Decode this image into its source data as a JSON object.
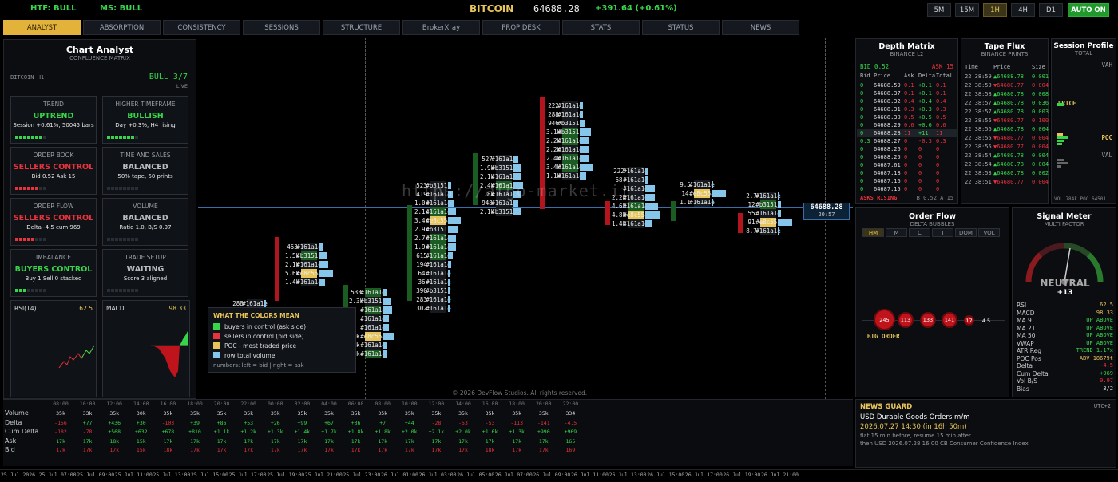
{
  "topbar": {
    "htf": "HTF: BULL",
    "ms": "MS: BULL",
    "symbol": "BITCOIN",
    "price": "64688.28",
    "change": "+391.64 (+0.61%)",
    "timeframes": [
      "5M",
      "15M",
      "1H",
      "4H",
      "D1"
    ],
    "auto": "AUTO ON"
  },
  "tabs": [
    "ANALYST",
    "ABSORPTION",
    "CONSISTENCY",
    "SESSIONS",
    "STRUCTURE",
    "BrokerXray",
    "PROP DESK",
    "STATS",
    "STATUS",
    "NEWS"
  ],
  "analyst": {
    "title": "Chart Analyst",
    "subtitle": "CONFLUENCE MATRIX",
    "symbol": "BITCOIN  H1",
    "bull": "BULL 3/7",
    "live": "LIVE",
    "cards": [
      {
        "h": "TREND",
        "v": "UPTREND",
        "s": "Session +0.61%, 50045 bars",
        "c": "green",
        "n": 7
      },
      {
        "h": "HIGHER TIMEFRAME",
        "v": "BULLISH",
        "s": "Day +0.3%, H4 rising",
        "c": "green",
        "n": 7
      },
      {
        "h": "ORDER BOOK",
        "v": "SELLERS CONTROL",
        "s": "Bid 0.52  Ask 15",
        "c": "red",
        "n": 6
      },
      {
        "h": "TIME AND SALES",
        "v": "BALANCED",
        "s": "50% tape, 60 prints",
        "c": "gray",
        "n": 0
      },
      {
        "h": "ORDER FLOW",
        "v": "SELLERS CONTROL",
        "s": "Delta -4.5 cum 969",
        "c": "red",
        "n": 5
      },
      {
        "h": "VOLUME",
        "v": "BALANCED",
        "s": "Ratio 1.0, B/S 0.97",
        "c": "gray",
        "n": 0
      },
      {
        "h": "IMBALANCE",
        "v": "BUYERS CONTROL",
        "s": "Buy 1  Sell 0 stacked",
        "c": "green",
        "n": 3
      },
      {
        "h": "TRADE SETUP",
        "v": "WAITING",
        "s": "Score 3 aligned",
        "c": "gray",
        "n": 0
      }
    ],
    "rsi_label": "RSI(14)",
    "rsi": "62.5",
    "macd_label": "MACD",
    "macd": "98.33"
  },
  "legend": {
    "title": "WHAT THE COLORS MEAN",
    "items": [
      "buyers in control (ask side)",
      "sellers in control (bid side)",
      "POC - most traded price",
      "row total volume"
    ],
    "note": "numbers:  left = bid  |  right = ask"
  },
  "watermark": "https://algo-market.it",
  "copyright": "© 2026 DevFlow Studios. All rights reserved.",
  "price_tag": {
    "price": "64688.28",
    "timer": "20:57"
  },
  "stats_table": {
    "labels": [
      "Volume",
      "Delta",
      "Cum Delta",
      "Ask",
      "Bid"
    ],
    "times": [
      "08:00",
      "10:00",
      "12:00",
      "14:00",
      "16:00",
      "18:00",
      "20:00",
      "22:00",
      "00:00",
      "02:00",
      "04:00",
      "06:00",
      "08:00",
      "10:00",
      "12:00",
      "14:00",
      "16:00",
      "18:00",
      "20:00",
      "22:00"
    ],
    "volume": [
      "35k",
      "33k",
      "35k",
      "30k",
      "35k",
      "35k",
      "35k",
      "35k",
      "35k",
      "35k",
      "35k",
      "35k",
      "35k",
      "35k",
      "35k",
      "35k",
      "35k",
      "35k",
      "35k",
      "334"
    ],
    "delta": [
      "-156",
      "+77",
      "+436",
      "+30",
      "-103",
      "+39",
      "+86",
      "+53",
      "+26",
      "+99",
      "+67",
      "+36",
      "+7",
      "+44",
      "-28",
      "-53",
      "-53",
      "-113",
      "-141",
      "-4.5"
    ],
    "cumdelta": [
      "-182",
      "-78",
      "+568",
      "+632",
      "+678",
      "+810",
      "+1.1k",
      "+1.2k",
      "+1.3k",
      "+1.4k",
      "+1.7k",
      "+1.8k",
      "+1.8k",
      "+2.0k",
      "+2.1k",
      "+2.0k",
      "+1.6k",
      "+1.3k",
      "+990",
      "+969"
    ],
    "ask": [
      "17k",
      "17k",
      "18k",
      "15k",
      "17k",
      "17k",
      "17k",
      "17k",
      "17k",
      "17k",
      "17k",
      "17k",
      "17k",
      "17k",
      "17k",
      "17k",
      "17k",
      "17k",
      "17k",
      "165"
    ],
    "bid": [
      "17k",
      "17k",
      "17k",
      "15k",
      "18k",
      "17k",
      "17k",
      "17k",
      "17k",
      "17k",
      "17k",
      "17k",
      "17k",
      "17k",
      "17k",
      "17k",
      "18k",
      "17k",
      "17k",
      "169"
    ]
  },
  "dates": [
    "25 Jul 2026",
    "25 Jul 07:00",
    "25 Jul 09:00",
    "25 Jul 11:00",
    "25 Jul 13:00",
    "25 Jul 15:00",
    "25 Jul 17:00",
    "25 Jul 19:00",
    "25 Jul 21:00",
    "25 Jul 23:00",
    "26 Jul 01:00",
    "26 Jul 03:00",
    "26 Jul 05:00",
    "26 Jul 07:00",
    "26 Jul 09:00",
    "26 Jul 11:00",
    "26 Jul 13:00",
    "26 Jul 15:00",
    "26 Jul 17:00",
    "26 Jul 19:00",
    "26 Jul 21:00"
  ],
  "depth": {
    "title": "Depth Matrix",
    "sub": "BINANCE L2",
    "bid": "BID 0.52",
    "ask": "ASK 15",
    "cols": [
      "Bid",
      "Price",
      "Ask",
      "Delta",
      "Total"
    ],
    "rows": [
      [
        "0",
        "64688.59",
        "0.1",
        "+0.1",
        "0.1"
      ],
      [
        "0",
        "64688.37",
        "0.1",
        "+0.1",
        "0.1"
      ],
      [
        "0",
        "64688.32",
        "0.4",
        "+0.4",
        "0.4"
      ],
      [
        "0",
        "64688.31",
        "0.3",
        "+0.3",
        "0.3"
      ],
      [
        "0",
        "64688.30",
        "0.5",
        "+0.5",
        "0.5"
      ],
      [
        "0",
        "64688.29",
        "0.6",
        "+0.6",
        "0.6"
      ],
      [
        "0",
        "64688.28",
        "11",
        "+11",
        "11"
      ],
      [
        "0.3",
        "64688.27",
        "0",
        "-0.3",
        "0.3"
      ],
      [
        "0",
        "64688.26",
        "0",
        "0",
        "0"
      ],
      [
        "0",
        "64688.25",
        "0",
        "0",
        "0"
      ],
      [
        "0",
        "64687.61",
        "0",
        "0",
        "0"
      ],
      [
        "0",
        "64687.18",
        "0",
        "0",
        "0"
      ],
      [
        "0",
        "64687.16",
        "0",
        "0",
        "0"
      ],
      [
        "0",
        "64687.15",
        "0",
        "0",
        "0"
      ]
    ],
    "foot": "ASKS RISING",
    "foot2": "B 0.52  A 15"
  },
  "tape": {
    "title": "Tape Flux",
    "sub": "BINANCE PRINTS",
    "cols": [
      "Time",
      "Price",
      "Size"
    ],
    "rows": [
      [
        "22:38:59",
        "▲64688.78",
        "0.001"
      ],
      [
        "22:38:59",
        "▼64680.77",
        "0.004"
      ],
      [
        "22:38:58",
        "▲64680.78",
        "0.008"
      ],
      [
        "22:38:57",
        "▲64680.78",
        "0.036"
      ],
      [
        "22:38:57",
        "▲64680.78",
        "0.003"
      ],
      [
        "22:38:56",
        "▼64680.77",
        "0.100"
      ],
      [
        "22:38:56",
        "▲64680.78",
        "0.004"
      ],
      [
        "22:38:55",
        "▼64680.77",
        "0.004"
      ],
      [
        "22:38:55",
        "▼64680.77",
        "0.004"
      ],
      [
        "22:38:54",
        "▲64680.78",
        "0.004"
      ],
      [
        "22:38:54",
        "▲64680.78",
        "0.004"
      ],
      [
        "22:38:53",
        "▲64680.78",
        "0.002"
      ],
      [
        "22:38:51",
        "▼64680.77",
        "0.004"
      ]
    ]
  },
  "session": {
    "title": "Session Profile",
    "sub": "TOTAL",
    "vah": "VAH",
    "price": "PRICE",
    "poc": "POC",
    "val": "VAL",
    "foot": "VOL 784k  POC 64501"
  },
  "orderflow": {
    "title": "Order Flow",
    "sub": "DELTA BUBBLES",
    "tabs": [
      "HM",
      "M",
      "C",
      "T",
      "DOM",
      "VOL"
    ],
    "bubbles": [
      "245",
      "113",
      "133",
      "141",
      "17",
      "4.5"
    ],
    "big": "BIG ORDER"
  },
  "signal": {
    "title": "Signal Meter",
    "sub": "MULTI FACTOR",
    "state": "NEUTRAL",
    "score": "+13",
    "rows": [
      [
        "RSI",
        "62.5"
      ],
      [
        "MACD",
        "98.33"
      ],
      [
        "MA 9",
        "UP ABOVE"
      ],
      [
        "MA 21",
        "UP ABOVE"
      ],
      [
        "MA 50",
        "UP ABOVE"
      ],
      [
        "VWAP",
        "UP ABOVE"
      ],
      [
        "ATR Reg",
        "TREND 1.17x"
      ],
      [
        "POC Pos",
        "ABV 18679t"
      ],
      [
        "Delta",
        "-4.5"
      ],
      [
        "Cum Delta",
        "+969"
      ],
      [
        "Vol B/S",
        "0.97"
      ],
      [
        "Bias",
        "3/2"
      ]
    ]
  },
  "news": {
    "title": "NEWS GUARD",
    "tz": "UTC+2",
    "event": "USD  Durable Goods Orders m/m",
    "when": "2026.07.27 14:30  (in 16h 50m)",
    "l1": "flat 15 min before, resume 15 min after",
    "l2": "then USD 2026.07.28 16:00  CB Consumer Confidence Index"
  },
  "colors": {
    "green": "#37d64a",
    "red": "#e8323c",
    "gold": "#e8c55a",
    "blue": "#86c6ea"
  }
}
